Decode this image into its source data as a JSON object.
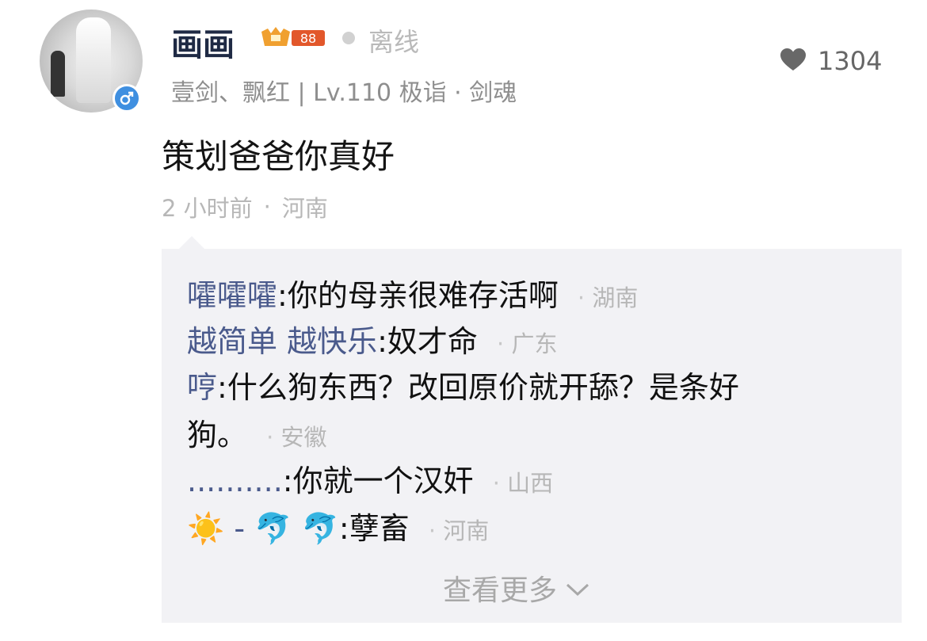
{
  "post": {
    "username": "画画",
    "level_badge": "88",
    "status": "离线",
    "like_count": "1304",
    "subtitle": "壹剑、飘红 | Lv.110 极诣 · 剑魂",
    "content": "策划爸爸你真好",
    "time": "2 小时前",
    "location": "河南"
  },
  "replies": [
    {
      "name": "嚯嚯嚯",
      "text": ":你的母亲很难存活啊",
      "location": "湖南"
    },
    {
      "name": "越简单 越快乐",
      "text": ":奴才命",
      "location": "广东"
    },
    {
      "name": "哼",
      "text": ":什么狗东西？改回原价就开舔？是条好",
      "text2": "狗。",
      "location": "安徽"
    },
    {
      "name": "..........",
      "text": ":你就一个汉奸",
      "location": "山西"
    },
    {
      "name": "☀️ - 🐬 🐬",
      "text": ":孽畜",
      "location": "河南"
    }
  ],
  "view_more": "查看更多",
  "icons": {
    "gender": "male-icon",
    "likes": "heart-icon",
    "view_more": "chevron-down-icon"
  },
  "colors": {
    "name_blue": "#4a5a8c",
    "badge_orange": "#f0a030",
    "gender_blue": "#3f8fe0"
  }
}
